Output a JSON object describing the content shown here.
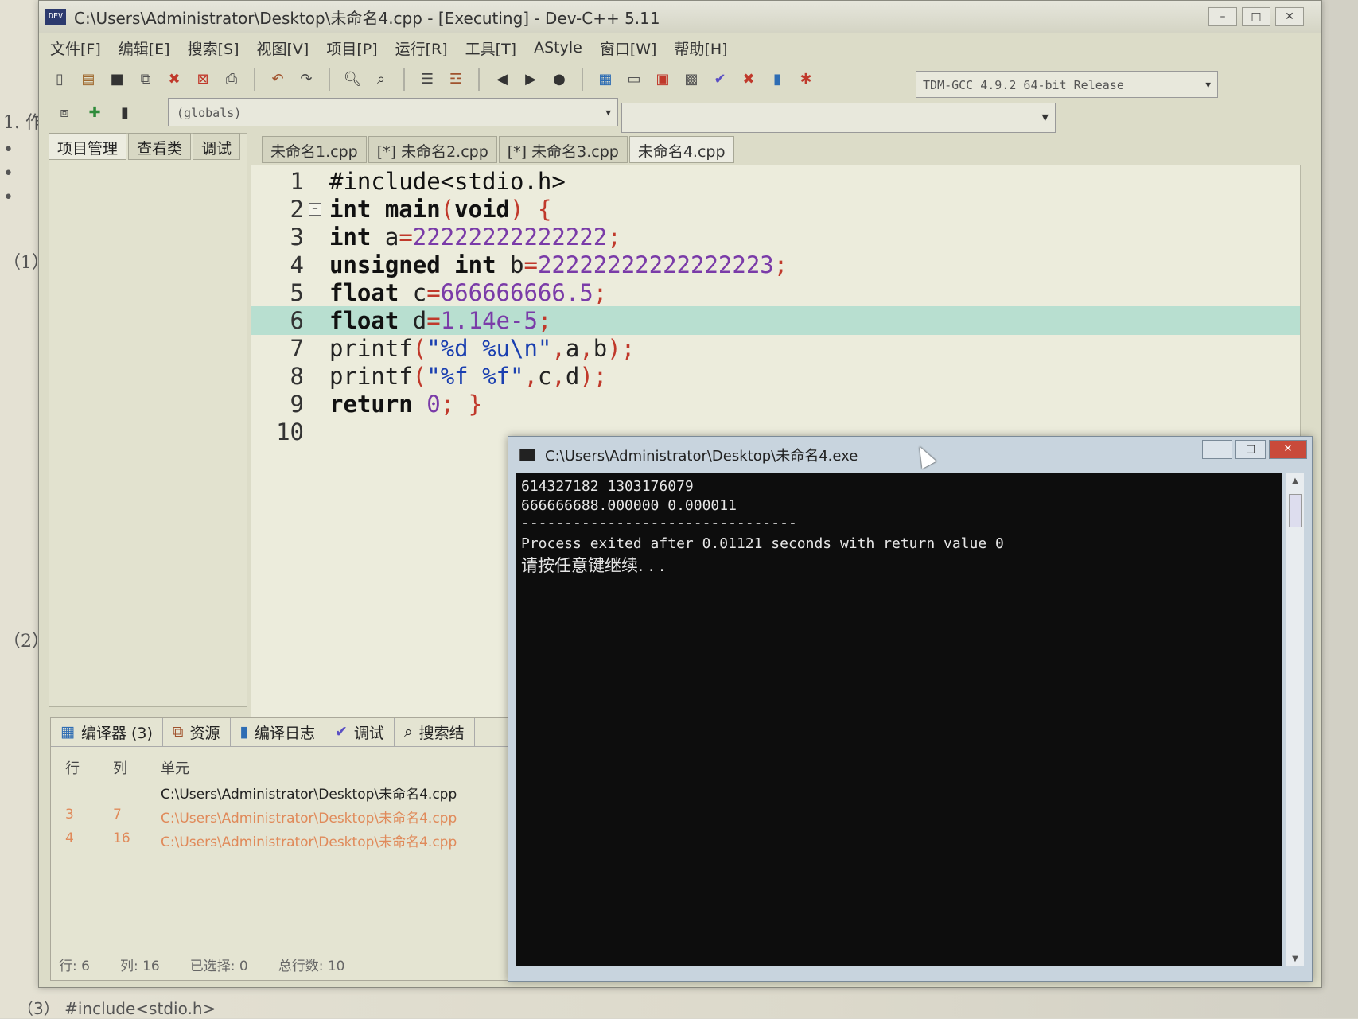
{
  "document": {
    "margin_labels": [
      "1. 作",
      "•",
      "•",
      "•",
      "（1）",
      "（2）"
    ],
    "bottom_line": "（3） #include<stdio.h>"
  },
  "ide": {
    "title": "C:\\Users\\Administrator\\Desktop\\未命名4.cpp - [Executing] - Dev-C++ 5.11",
    "icon_text": "DEV",
    "menu": [
      "文件[F]",
      "编辑[E]",
      "搜索[S]",
      "视图[V]",
      "项目[P]",
      "运行[R]",
      "工具[T]",
      "AStyle",
      "窗口[W]",
      "帮助[H]"
    ],
    "compiler": "TDM-GCC 4.9.2 64-bit Release",
    "globals": "(globals)",
    "left_tabs": [
      "项目管理",
      "查看类",
      "调试"
    ],
    "editor_tabs": [
      "未命名1.cpp",
      "[*] 未命名2.cpp",
      "[*] 未命名3.cpp",
      "未命名4.cpp"
    ],
    "code_lines": [
      {
        "n": "1",
        "text": "#include<stdio.h>"
      },
      {
        "n": "2",
        "text": "int main(void) {"
      },
      {
        "n": "3",
        "text": "int a=22222222222222;"
      },
      {
        "n": "4",
        "text": "unsigned int b=22222222222222223;"
      },
      {
        "n": "5",
        "text": "float c=666666666.5;"
      },
      {
        "n": "6",
        "text": "float d=1.14e-5;"
      },
      {
        "n": "7",
        "text": "printf(\"%d %u\\n\",a,b);"
      },
      {
        "n": "8",
        "text": "printf(\"%f %f\",c,d);"
      },
      {
        "n": "9",
        "text": "return 0; }"
      },
      {
        "n": "10",
        "text": ""
      }
    ],
    "highlighted_line": 6,
    "bottom_tabs": [
      "编译器 (3)",
      "资源",
      "编译日志",
      "调试",
      "搜索结"
    ],
    "messages": {
      "headers": [
        "行",
        "列",
        "单元"
      ],
      "rows": [
        {
          "line": "",
          "col": "",
          "unit": "C:\\Users\\Administrator\\Desktop\\未命名4.cpp"
        },
        {
          "line": "3",
          "col": "7",
          "unit": "C:\\Users\\Administrator\\Desktop\\未命名4.cpp"
        },
        {
          "line": "4",
          "col": "16",
          "unit": "C:\\Users\\Administrator\\Desktop\\未命名4.cpp"
        }
      ]
    },
    "status": {
      "row_label": "行:",
      "row": "6",
      "col_label": "列:",
      "col": "16",
      "sel_label": "已选择:",
      "sel": "0",
      "total_label": "总行数:",
      "total": "10"
    }
  },
  "console": {
    "title": "C:\\Users\\Administrator\\Desktop\\未命名4.exe",
    "lines": [
      "614327182 1303176079",
      "666666688.000000 0.000011",
      "--------------------------------",
      "Process exited after 0.01121 seconds with return value 0",
      "请按任意键继续. . ."
    ]
  },
  "colors": {
    "editor_bg": "#ececdc",
    "highlight_line": "#b8dfd0",
    "console_bg": "#0d0d0d",
    "warning_text": "#e08a5a"
  }
}
